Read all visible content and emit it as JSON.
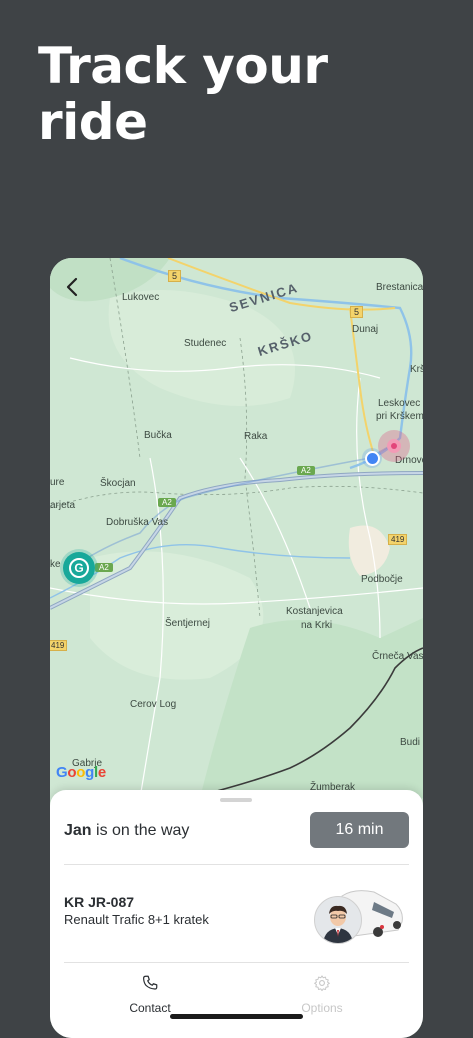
{
  "headline": "Track your ride",
  "map": {
    "labels": {
      "lukovec": "Lukovec",
      "sevnica": "SEVNICA",
      "brestanica": "Brestanica",
      "studenec": "Studenec",
      "krsko": "KRŠKO",
      "dunaj": "Dunaj",
      "krs": "Krš",
      "leskovec_1": "Leskovec",
      "leskovec_2": "pri Krškem",
      "bucka": "Bučka",
      "raka": "Raka",
      "drnovo": "Drnovo",
      "ure": "ure",
      "skocjan": "Škocjan",
      "arjeta": "arjeta",
      "dobruska": "Dobruška Vas",
      "ke": "ke",
      "sentjernej": "Šentjernej",
      "kostanjevica_1": "Kostanjevica",
      "kostanjevica_2": "na Krki",
      "podbocje": "Podbočje",
      "cerneca": "Črneča Vas",
      "cerov": "Cerov Log",
      "budi": "Budi",
      "gabrje": "Gabrje",
      "zumberak": "Žumberak"
    },
    "road_shields": {
      "r5a": "5",
      "r5b": "5",
      "a2a": "A2",
      "a2b": "A2",
      "a2c": "A2",
      "r419a": "419",
      "r419b": "419"
    },
    "start_marker_letter": "G",
    "attribution": "Google"
  },
  "trip": {
    "driver_name": "Jan",
    "status_suffix": "is on the way",
    "eta": "16 min",
    "plate": "KR JR-087",
    "vehicle_model": "Renault Trafic 8+1 kratek"
  },
  "nav": {
    "contact": "Contact",
    "options": "Options"
  },
  "colors": {
    "background": "#3f4346",
    "map_green": "#cfe7d3",
    "eta_button": "#72787d",
    "user_dot": "#4285f4",
    "destination": "#e2457a",
    "start_marker": "#18a89a"
  },
  "icons": {
    "back": "chevron-left-icon",
    "contact": "phone-icon",
    "options": "gear-icon"
  }
}
